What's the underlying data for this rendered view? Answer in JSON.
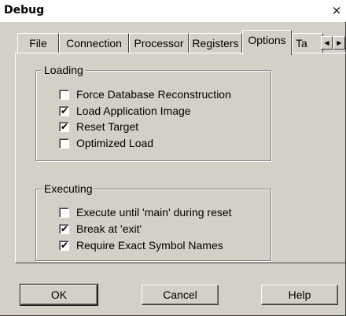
{
  "window": {
    "title": "Debug",
    "close_glyph": "×"
  },
  "tabs": [
    {
      "label": "File"
    },
    {
      "label": "Connection"
    },
    {
      "label": "Processor"
    },
    {
      "label": "Registers"
    },
    {
      "label": "Options",
      "active": true
    },
    {
      "label": "Ta"
    }
  ],
  "tab_scroll": {
    "left_icon": "◀",
    "right_icon": "▶"
  },
  "groups": {
    "loading": {
      "label": "Loading",
      "items": [
        {
          "label": "Force Database Reconstruction",
          "checked": false
        },
        {
          "label": "Load Application Image",
          "checked": true
        },
        {
          "label": "Reset Target",
          "checked": true
        },
        {
          "label": "Optimized Load",
          "checked": false
        }
      ]
    },
    "executing": {
      "label": "Executing",
      "items": [
        {
          "label": "Execute until 'main' during reset",
          "checked": false
        },
        {
          "label": "Break at 'exit'",
          "checked": true
        },
        {
          "label": "Require Exact Symbol Names",
          "checked": true
        }
      ]
    }
  },
  "buttons": {
    "ok": "OK",
    "cancel": "Cancel",
    "help": "Help"
  },
  "check_glyph": "✔"
}
